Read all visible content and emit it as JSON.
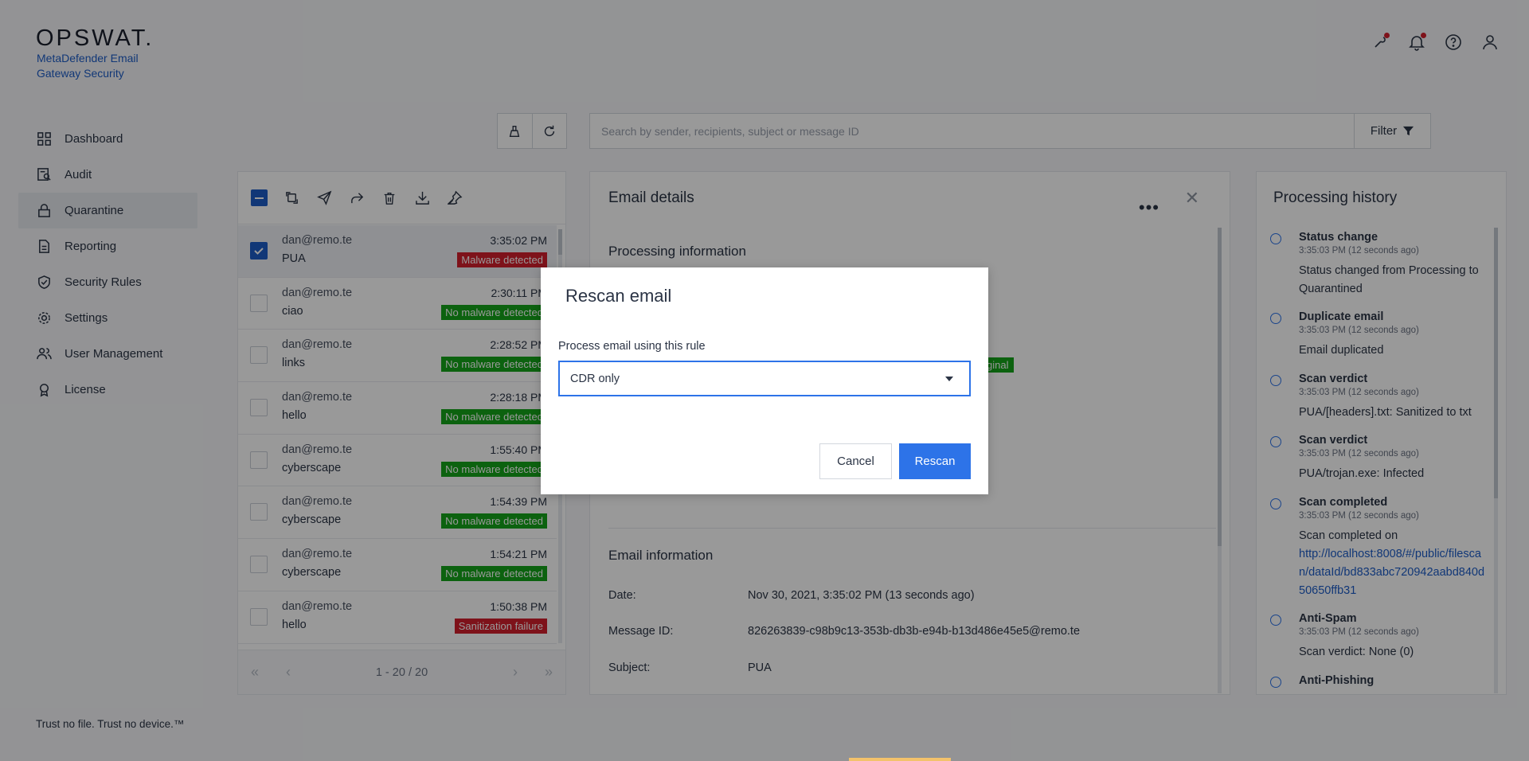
{
  "brand": {
    "logo": "OPSWAT.",
    "product": "MetaDefender Email Gateway Security"
  },
  "nav": [
    {
      "label": "Dashboard",
      "icon": "dashboard-icon"
    },
    {
      "label": "Audit",
      "icon": "audit-icon"
    },
    {
      "label": "Quarantine",
      "icon": "lock-icon",
      "active": true
    },
    {
      "label": "Reporting",
      "icon": "document-icon"
    },
    {
      "label": "Security Rules",
      "icon": "shield-check-icon"
    },
    {
      "label": "Settings",
      "icon": "gear-icon"
    },
    {
      "label": "User Management",
      "icon": "users-icon"
    },
    {
      "label": "License",
      "icon": "badge-icon"
    }
  ],
  "footer": "Trust no file. Trust no device.™",
  "search": {
    "placeholder": "Search by sender, recipients, subject or message ID",
    "filter_label": "Filter"
  },
  "emails": [
    {
      "from": "dan@remo.te",
      "subject": "PUA",
      "time": "3:35:02 PM",
      "status": "Malware detected",
      "status_color": "#d21f2c",
      "selected": true
    },
    {
      "from": "dan@remo.te",
      "subject": "ciao",
      "time": "2:30:11 PM",
      "status": "No malware detected",
      "status_color": "#15a31a"
    },
    {
      "from": "dan@remo.te",
      "subject": "links",
      "time": "2:28:52 PM",
      "status": "No malware detected",
      "status_color": "#15a31a"
    },
    {
      "from": "dan@remo.te",
      "subject": "hello",
      "time": "2:28:18 PM",
      "status": "No malware detected",
      "status_color": "#15a31a"
    },
    {
      "from": "dan@remo.te",
      "subject": "cyberscape",
      "time": "1:55:40 PM",
      "status": "No malware detected",
      "status_color": "#15a31a"
    },
    {
      "from": "dan@remo.te",
      "subject": "cyberscape",
      "time": "1:54:39 PM",
      "status": "No malware detected",
      "status_color": "#15a31a"
    },
    {
      "from": "dan@remo.te",
      "subject": "cyberscape",
      "time": "1:54:21 PM",
      "status": "No malware detected",
      "status_color": "#15a31a"
    },
    {
      "from": "dan@remo.te",
      "subject": "hello",
      "time": "1:50:38 PM",
      "status": "Sanitization failure",
      "status_color": "#d21f2c"
    }
  ],
  "pager": {
    "range": "1 - 20 / 20"
  },
  "details": {
    "title": "Email details",
    "processing_title": "Processing information",
    "original_badge": "ginal",
    "email_info_title": "Email information",
    "date_label": "Date:",
    "date_value": "Nov 30, 2021, 3:35:02 PM (13 seconds ago)",
    "msgid_label": "Message ID:",
    "msgid_value": "826263839-c98b9c13-353b-db3b-e94b-b13d486e45e5@remo.te",
    "subject_label": "Subject:",
    "subject_value": "PUA"
  },
  "history": {
    "title": "Processing history",
    "events": [
      {
        "title": "Status change",
        "time": "3:35:03 PM (12 seconds ago)",
        "message": "Status changed from Processing to Quarantined"
      },
      {
        "title": "Duplicate email",
        "time": "3:35:03 PM (12 seconds ago)",
        "message": "Email duplicated"
      },
      {
        "title": "Scan verdict",
        "time": "3:35:03 PM (12 seconds ago)",
        "message": "PUA/[headers].txt: Sanitized to txt"
      },
      {
        "title": "Scan verdict",
        "time": "3:35:03 PM (12 seconds ago)",
        "message": "PUA/trojan.exe: Infected"
      },
      {
        "title": "Scan completed",
        "time": "3:35:03 PM (12 seconds ago)",
        "message": "Scan completed on",
        "link": "http://localhost:8008/#/public/filescan/dataId/bd833abc720942aabd840d50650ffb31"
      },
      {
        "title": "Anti-Spam",
        "time": "3:35:03 PM (12 seconds ago)",
        "message": "Scan verdict: None (0)"
      },
      {
        "title": "Anti-Phishing",
        "time": "",
        "message": ""
      }
    ]
  },
  "modal": {
    "title": "Rescan email",
    "rule_label": "Process email using this rule",
    "rule_value": "CDR only",
    "cancel_label": "Cancel",
    "rescan_label": "Rescan"
  }
}
